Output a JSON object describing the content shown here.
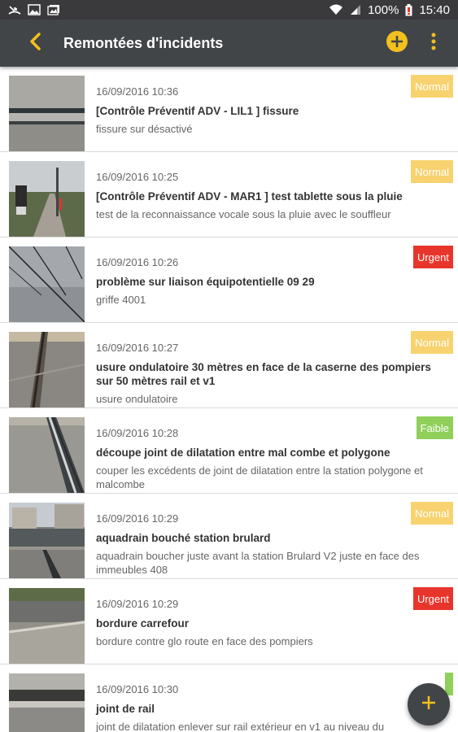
{
  "status_bar": {
    "battery": "100%",
    "time": "15:40"
  },
  "app_bar": {
    "title": "Remontées d'incidents"
  },
  "colors": {
    "accent": "#f2c01f",
    "normal": "#f7d26e",
    "urgent": "#e8352b",
    "faible": "#8fcf5a",
    "appbar": "#424548"
  },
  "incidents": [
    {
      "date": "16/09/2016 10:36",
      "title": "[Contrôle Préventif ADV - LIL1 ] fissure",
      "description": "fissure sur désactivé",
      "priority": "Normal"
    },
    {
      "date": "16/09/2016 10:25",
      "title": "[Contrôle Préventif ADV - MAR1 ] test tablette sous la pluie",
      "description": "test de la reconnaissance vocale sous la pluie avec le souffleur",
      "priority": "Normal"
    },
    {
      "date": "16/09/2016 10:26",
      "title": "problème sur liaison équipotentielle 09 29",
      "description": "griffe 4001",
      "priority": "Urgent"
    },
    {
      "date": "16/09/2016 10:27",
      "title": "usure ondulatoire 30 mètres en face de la caserne des pompiers sur 50 mètres rail et v1",
      "description": "usure ondulatoire",
      "priority": "Normal"
    },
    {
      "date": "16/09/2016 10:28",
      "title": "découpe joint de dilatation entre mal combe et polygone",
      "description": "couper les excédents de joint de dilatation entre la station polygone et malcombe",
      "priority": "Faible"
    },
    {
      "date": "16/09/2016 10:29",
      "title": "aquadrain bouché station brulard",
      "description": "aquadrain boucher juste avant la station Brulard V2 juste en face des immeubles 408",
      "priority": "Normal"
    },
    {
      "date": "16/09/2016 10:29",
      "title": "bordure carrefour",
      "description": "bordure contre glo route en face des pompiers",
      "priority": "Urgent"
    },
    {
      "date": "16/09/2016 10:30",
      "title": "joint de rail",
      "description": "joint de dilatation enlever sur rail extérieur en v1 au niveau du",
      "priority": ""
    }
  ]
}
